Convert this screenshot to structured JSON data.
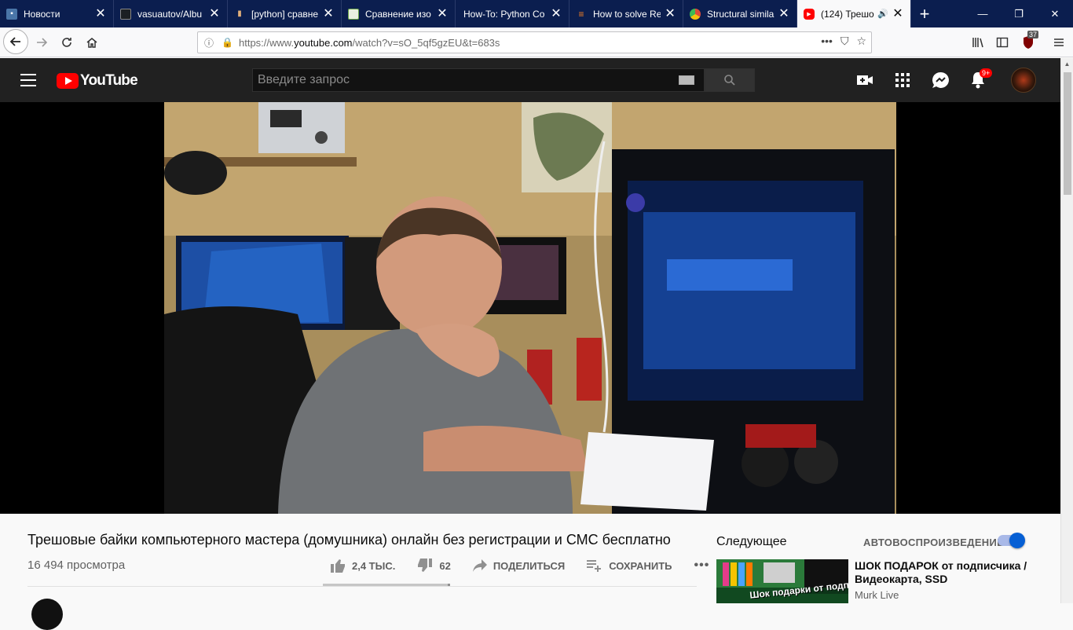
{
  "browser": {
    "tabs": [
      {
        "title": "Новости",
        "favicon": "chat-icon",
        "favicon_color": "#4a76a8"
      },
      {
        "title": "vasuautov/Albu",
        "favicon": "github-icon",
        "favicon_color": "#ffffff"
      },
      {
        "title": "[python] сравне",
        "favicon": "bottle-icon",
        "favicon_color": "#e2b07a"
      },
      {
        "title": "Сравнение изо",
        "favicon": "sketch-icon",
        "favicon_color": "#6ba54a"
      },
      {
        "title": "How-To: Python Co",
        "favicon": "",
        "favicon_color": ""
      },
      {
        "title": "How to solve Re",
        "favicon": "stackoverflow-icon",
        "favicon_color": "#f48024"
      },
      {
        "title": "Structural simila",
        "favicon": "chrome-icon",
        "favicon_color": "#dd4b39"
      },
      {
        "title": "(124) Трешо",
        "favicon": "youtube-icon",
        "favicon_color": "#ff0000",
        "active": true
      }
    ],
    "url": {
      "prefix": "https://www.",
      "domain": "youtube.com",
      "path": "/watch?v=sO_5qf5gzEU&t=683s"
    },
    "ublock_count": "37"
  },
  "youtube": {
    "logo_text": "YouTube",
    "search_placeholder": "Введите запрос",
    "notification_badge": "9+",
    "video": {
      "title": "Трешовые байки компьютерного мастера (домушника) онлайн без регистрации и СМС бесплатно",
      "views": "16 494 просмотра",
      "likes": "2,4 ТЫС.",
      "dislikes": "62",
      "like_ratio": 0.98,
      "share_label": "ПОДЕЛИТЬСЯ",
      "save_label": "СОХРАНИТЬ"
    },
    "sidebar": {
      "up_next_label": "Следующее",
      "autoplay_label": "АВТОВОСПРОИЗВЕДЕНИЕ",
      "autoplay_on": true,
      "recommended": [
        {
          "title": "ШОК ПОДАРОК от подписчика / Видеокарта, SSD",
          "channel": "Murk Live",
          "thumb_caption": "Шок подарки от подписчика"
        }
      ]
    }
  },
  "colors": {
    "masthead": "#212121",
    "brand_red": "#ff0000",
    "tabstrip": "#0b1e4f",
    "toggle_blue": "#065fd4"
  }
}
